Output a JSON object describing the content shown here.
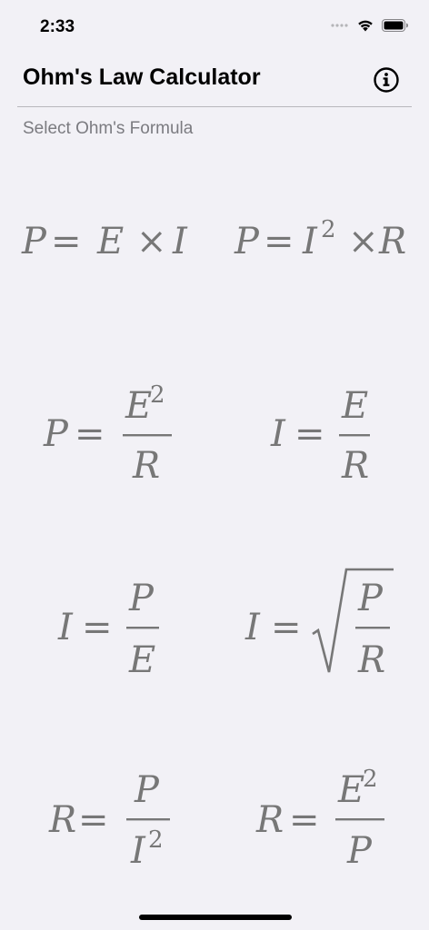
{
  "status_bar": {
    "time": "2:33"
  },
  "header": {
    "title": "Ohm's Law Calculator",
    "info_icon": "info-icon"
  },
  "subtitle": "Select Ohm's Formula",
  "formulas": [
    {
      "name": "P = E × I",
      "lhs": "P",
      "a": "E",
      "op": "×",
      "b": "I"
    },
    {
      "name": "P = I² × R",
      "lhs": "P",
      "a": "I",
      "exp": "2",
      "op": "×",
      "b": "R"
    },
    {
      "name": "P = E² / R",
      "lhs": "P",
      "num": "E",
      "num_exp": "2",
      "den": "R"
    },
    {
      "name": "I = E / R",
      "lhs": "I",
      "num": "E",
      "den": "R"
    },
    {
      "name": "I = P / E",
      "lhs": "I",
      "num": "P",
      "den": "E"
    },
    {
      "name": "I = √(P / R)",
      "lhs": "I",
      "num": "P",
      "den": "R"
    },
    {
      "name": "R = P / I²",
      "lhs": "R",
      "num": "P",
      "den": "I",
      "den_exp": "2"
    },
    {
      "name": "R = E² / P",
      "lhs": "R",
      "num": "E",
      "num_exp": "2",
      "den": "P"
    }
  ]
}
